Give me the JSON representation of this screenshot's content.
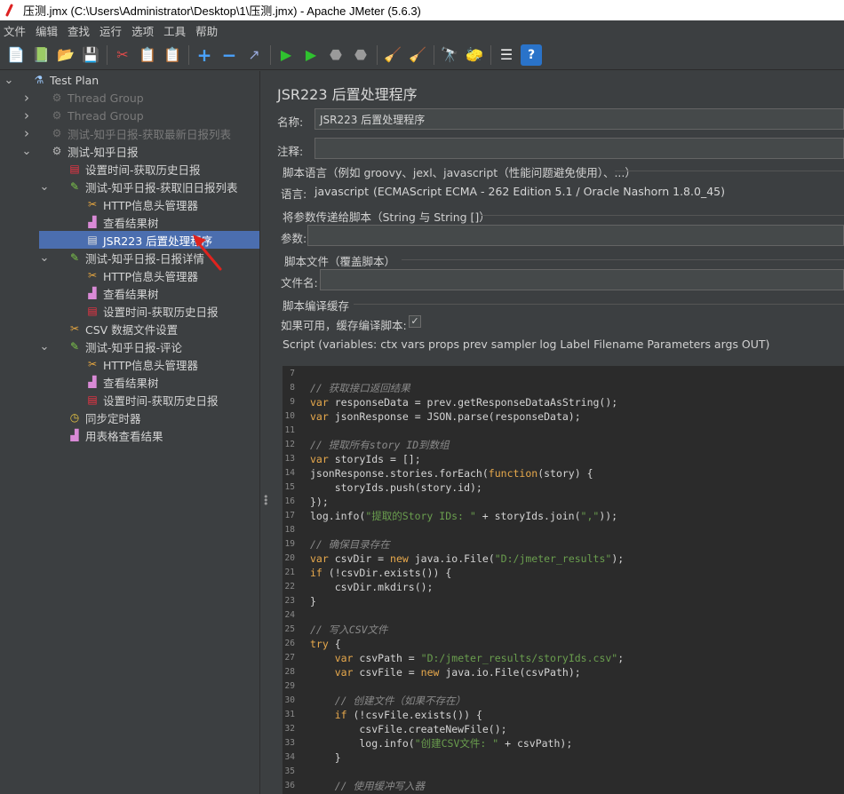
{
  "window": {
    "title": "压测.jmx (C:\\Users\\Administrator\\Desktop\\1\\压测.jmx) - Apache JMeter (5.6.3)"
  },
  "menu": [
    "文件",
    "编辑",
    "查找",
    "运行",
    "选项",
    "工具",
    "帮助"
  ],
  "toolbar": [
    {
      "name": "new-icon",
      "glyph": "📄"
    },
    {
      "name": "templates-icon",
      "glyph": "📗"
    },
    {
      "name": "open-icon",
      "glyph": "📂"
    },
    {
      "name": "save-icon",
      "glyph": "💾"
    },
    {
      "sep": true
    },
    {
      "name": "cut-icon",
      "glyph": "✂"
    },
    {
      "name": "copy-icon",
      "glyph": "📋"
    },
    {
      "name": "paste-icon",
      "glyph": "📋"
    },
    {
      "sep": true
    },
    {
      "name": "expand-icon",
      "glyph": "+"
    },
    {
      "name": "collapse-icon",
      "glyph": "−"
    },
    {
      "name": "toggle-icon",
      "glyph": "↗"
    },
    {
      "sep": true
    },
    {
      "name": "start-icon",
      "glyph": "▶"
    },
    {
      "name": "start-no-pause-icon",
      "glyph": "▶"
    },
    {
      "name": "stop-icon",
      "glyph": "⬣"
    },
    {
      "name": "shutdown-icon",
      "glyph": "⬣"
    },
    {
      "sep": true
    },
    {
      "name": "clear-icon",
      "glyph": "🧹"
    },
    {
      "name": "clear-all-icon",
      "glyph": "🧹"
    },
    {
      "sep": true
    },
    {
      "name": "search-icon",
      "glyph": "🔭"
    },
    {
      "name": "reset-search-icon",
      "glyph": "🧽"
    },
    {
      "sep": true
    },
    {
      "name": "function-helper-icon",
      "glyph": "☰"
    },
    {
      "name": "help-icon",
      "glyph": "?"
    }
  ],
  "tree": [
    {
      "label": "Test Plan",
      "indent": 0,
      "chev": "down",
      "icon": "flask",
      "state": "normal"
    },
    {
      "label": "Thread Group",
      "indent": 1,
      "chev": "right",
      "icon": "gear",
      "state": "disabled"
    },
    {
      "label": "Thread Group",
      "indent": 1,
      "chev": "right",
      "icon": "gear",
      "state": "disabled"
    },
    {
      "label": "测试-知乎日报-获取最新日报列表",
      "indent": 1,
      "chev": "right",
      "icon": "gear",
      "state": "disabled"
    },
    {
      "label": "测试-知乎日报",
      "indent": 1,
      "chev": "down",
      "icon": "gear",
      "state": "normal"
    },
    {
      "label": "设置时间-获取历史日报",
      "indent": 2,
      "chev": "",
      "icon": "doc",
      "state": "normal"
    },
    {
      "label": "测试-知乎日报-获取旧日报列表",
      "indent": 2,
      "chev": "down",
      "icon": "pipette",
      "state": "normal"
    },
    {
      "label": "HTTP信息头管理器",
      "indent": 3,
      "chev": "",
      "icon": "tools",
      "state": "normal"
    },
    {
      "label": "查看结果树",
      "indent": 3,
      "chev": "",
      "icon": "chart",
      "state": "normal"
    },
    {
      "label": "JSR223 后置处理程序",
      "indent": 3,
      "chev": "",
      "icon": "doc2",
      "state": "selected"
    },
    {
      "label": "测试-知乎日报-日报详情",
      "indent": 2,
      "chev": "down",
      "icon": "pipette",
      "state": "normal"
    },
    {
      "label": "HTTP信息头管理器",
      "indent": 3,
      "chev": "",
      "icon": "tools",
      "state": "normal"
    },
    {
      "label": "查看结果树",
      "indent": 3,
      "chev": "",
      "icon": "chart",
      "state": "normal"
    },
    {
      "label": "设置时间-获取历史日报",
      "indent": 3,
      "chev": "",
      "icon": "doc",
      "state": "normal"
    },
    {
      "label": "CSV 数据文件设置",
      "indent": 2,
      "chev": "",
      "icon": "tools",
      "state": "normal"
    },
    {
      "label": "测试-知乎日报-评论",
      "indent": 2,
      "chev": "down",
      "icon": "pipette",
      "state": "normal"
    },
    {
      "label": "HTTP信息头管理器",
      "indent": 3,
      "chev": "",
      "icon": "tools",
      "state": "normal"
    },
    {
      "label": "查看结果树",
      "indent": 3,
      "chev": "",
      "icon": "chart",
      "state": "normal"
    },
    {
      "label": "设置时间-获取历史日报",
      "indent": 3,
      "chev": "",
      "icon": "doc",
      "state": "normal"
    },
    {
      "label": "同步定时器",
      "indent": 2,
      "chev": "",
      "icon": "timer",
      "state": "normal"
    },
    {
      "label": "用表格查看结果",
      "indent": 2,
      "chev": "",
      "icon": "chart",
      "state": "normal"
    }
  ],
  "panel": {
    "heading": "JSR223 后置处理程序",
    "name_label": "名称:",
    "name_value": "JSR223 后置处理程序",
    "comment_label": "注释:",
    "comment_value": "",
    "script_lang_section": "脚本语言（例如 groovy、jexl、javascript（性能问题避免使用）、...）",
    "lang_label": "语言:",
    "lang_value": "javascript",
    "lang_desc": "(ECMAScript ECMA - 262 Edition 5.1 / Oracle Nashorn 1.8.0_45)",
    "params_section": "将参数传递给脚本（String 与 String []）",
    "params_label": "参数:",
    "params_value": "",
    "script_file_section": "脚本文件（覆盖脚本）",
    "file_label": "文件名:",
    "file_value": "",
    "cache_section": "脚本编译缓存",
    "cache_label": "如果可用，缓存编译脚本:",
    "cache_checked": true,
    "script_header": "Script (variables: ctx vars props prev sampler log Label Filename Parameters args OUT)"
  },
  "code": [
    {
      "n": "7",
      "t": [
        [
          "",
          ""
        ]
      ]
    },
    {
      "n": "8",
      "t": [
        [
          "cm",
          "// 获取接口返回结果"
        ]
      ]
    },
    {
      "n": "9",
      "t": [
        [
          "kw",
          "var"
        ],
        [
          "",
          " responseData = prev.getResponseDataAsString();"
        ]
      ]
    },
    {
      "n": "10",
      "t": [
        [
          "kw",
          "var"
        ],
        [
          "",
          " jsonResponse = JSON.parse(responseData);"
        ]
      ]
    },
    {
      "n": "11",
      "t": [
        [
          "",
          ""
        ]
      ]
    },
    {
      "n": "12",
      "t": [
        [
          "cm",
          "// 提取所有story ID到数组"
        ]
      ]
    },
    {
      "n": "13",
      "t": [
        [
          "kw",
          "var"
        ],
        [
          "",
          " storyIds = [];"
        ]
      ]
    },
    {
      "n": "14",
      "t": [
        [
          "",
          "jsonResponse.stories.forEach("
        ],
        [
          "kw",
          "function"
        ],
        [
          "",
          "(story) {"
        ]
      ]
    },
    {
      "n": "15",
      "t": [
        [
          "",
          "    storyIds.push(story.id);"
        ]
      ]
    },
    {
      "n": "16",
      "t": [
        [
          "",
          "});"
        ]
      ]
    },
    {
      "n": "17",
      "t": [
        [
          "",
          "log.info("
        ],
        [
          "str",
          "\"提取的Story IDs: \""
        ],
        [
          "",
          " + storyIds.join("
        ],
        [
          "str",
          "\",\""
        ],
        [
          "",
          "));"
        ]
      ]
    },
    {
      "n": "18",
      "t": [
        [
          "",
          ""
        ]
      ]
    },
    {
      "n": "19",
      "t": [
        [
          "cm",
          "// 确保目录存在"
        ]
      ]
    },
    {
      "n": "20",
      "t": [
        [
          "kw",
          "var"
        ],
        [
          "",
          " csvDir = "
        ],
        [
          "kw",
          "new"
        ],
        [
          "",
          " java.io.File("
        ],
        [
          "str",
          "\"D:/jmeter_results\""
        ],
        [
          "",
          ");"
        ]
      ]
    },
    {
      "n": "21",
      "t": [
        [
          "kw",
          "if"
        ],
        [
          "",
          " (!csvDir.exists()) {"
        ]
      ]
    },
    {
      "n": "22",
      "t": [
        [
          "",
          "    csvDir.mkdirs();"
        ]
      ]
    },
    {
      "n": "23",
      "t": [
        [
          "",
          "}"
        ]
      ]
    },
    {
      "n": "24",
      "t": [
        [
          "",
          ""
        ]
      ]
    },
    {
      "n": "25",
      "t": [
        [
          "cm",
          "// 写入CSV文件"
        ]
      ]
    },
    {
      "n": "26",
      "t": [
        [
          "kw",
          "try"
        ],
        [
          "",
          " {"
        ]
      ]
    },
    {
      "n": "27",
      "t": [
        [
          "",
          "    "
        ],
        [
          "kw",
          "var"
        ],
        [
          "",
          " csvPath = "
        ],
        [
          "str",
          "\"D:/jmeter_results/storyIds.csv\""
        ],
        [
          "",
          ";"
        ]
      ]
    },
    {
      "n": "28",
      "t": [
        [
          "",
          "    "
        ],
        [
          "kw",
          "var"
        ],
        [
          "",
          " csvFile = "
        ],
        [
          "kw",
          "new"
        ],
        [
          "",
          " java.io.File(csvPath);"
        ]
      ]
    },
    {
      "n": "29",
      "t": [
        [
          "",
          ""
        ]
      ]
    },
    {
      "n": "30",
      "t": [
        [
          "",
          "    "
        ],
        [
          "cm",
          "// 创建文件（如果不存在）"
        ]
      ]
    },
    {
      "n": "31",
      "t": [
        [
          "",
          "    "
        ],
        [
          "kw",
          "if"
        ],
        [
          "",
          " (!csvFile.exists()) {"
        ]
      ]
    },
    {
      "n": "32",
      "t": [
        [
          "",
          "        csvFile.createNewFile();"
        ]
      ]
    },
    {
      "n": "33",
      "t": [
        [
          "",
          "        log.info("
        ],
        [
          "str",
          "\"创建CSV文件: \""
        ],
        [
          "",
          " + csvPath);"
        ]
      ]
    },
    {
      "n": "34",
      "t": [
        [
          "",
          "    }"
        ]
      ]
    },
    {
      "n": "35",
      "t": [
        [
          "",
          ""
        ]
      ]
    },
    {
      "n": "36",
      "t": [
        [
          "",
          "    "
        ],
        [
          "cm",
          "// 使用缓冲写入器"
        ]
      ]
    }
  ]
}
